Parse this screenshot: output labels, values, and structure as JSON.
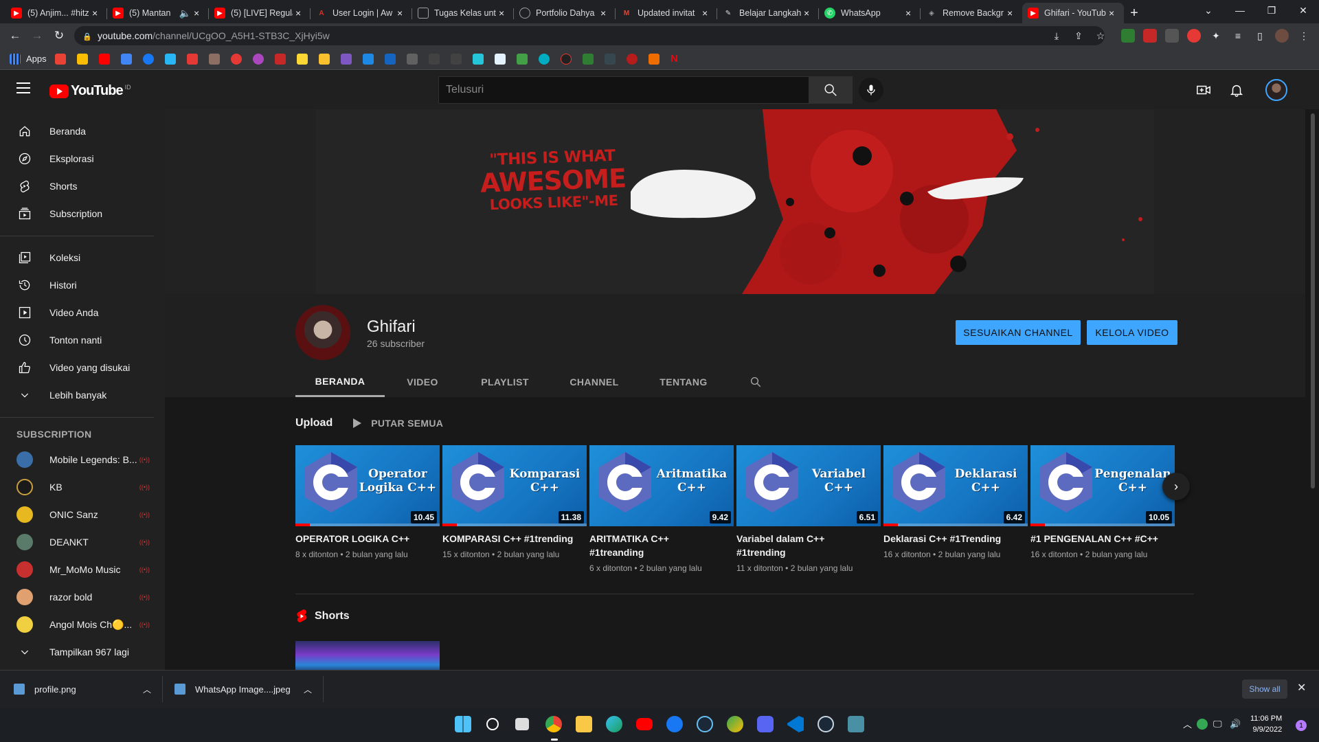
{
  "browser": {
    "tabs": [
      {
        "label": "(5) Anjim... #hitz",
        "favicon_color": "#ff0000"
      },
      {
        "label": "(5) Mantan",
        "favicon_color": "#ff0000"
      },
      {
        "label": "(5) [LIVE] Regula",
        "favicon_color": "#ff0000"
      },
      {
        "label": "User Login | Aw",
        "favicon_color": "#d93025"
      },
      {
        "label": "Tugas Kelas unt",
        "favicon_color": "#9aa0a6"
      },
      {
        "label": "Portfolio Dahya",
        "favicon_color": "#9aa0a6"
      },
      {
        "label": "Updated invitat",
        "favicon_color": "#ea4335"
      },
      {
        "label": "Belajar Langkah",
        "favicon_color": "#9aa0a6"
      },
      {
        "label": "WhatsApp",
        "favicon_color": "#25d366"
      },
      {
        "label": "Remove Backgr",
        "favicon_color": "#9aa0a6"
      },
      {
        "label": "Ghifari - YouTub",
        "favicon_color": "#ff0000"
      }
    ],
    "url_host": "youtube.com",
    "url_path": "/channel/UCgOO_A5H1-STB3C_XjHyi5w",
    "bookmarks_apps_label": "Apps"
  },
  "masthead": {
    "logo_text": "YouTube",
    "country_code": "ID",
    "search_placeholder": "Telusuri"
  },
  "sidebar": {
    "main_items": [
      {
        "label": "Beranda",
        "icon": "home-icon"
      },
      {
        "label": "Eksplorasi",
        "icon": "explore-icon"
      },
      {
        "label": "Shorts",
        "icon": "shorts-icon"
      },
      {
        "label": "Subscription",
        "icon": "subscriptions-icon"
      }
    ],
    "library_items": [
      {
        "label": "Koleksi",
        "icon": "library-icon"
      },
      {
        "label": "Histori",
        "icon": "history-icon"
      },
      {
        "label": "Video Anda",
        "icon": "your-videos-icon"
      },
      {
        "label": "Tonton nanti",
        "icon": "watch-later-icon"
      },
      {
        "label": "Video yang disukai",
        "icon": "liked-icon"
      },
      {
        "label": "Lebih banyak",
        "icon": "chevron-down-icon"
      }
    ],
    "subscription_heading": "SUBSCRIPTION",
    "subscriptions": [
      {
        "label": "Mobile Legends: B...",
        "color": "#3a6ea8",
        "live": true
      },
      {
        "label": "KB",
        "color": "#1a1a1a",
        "live": true
      },
      {
        "label": "ONIC Sanz",
        "color": "#e8b820",
        "live": true
      },
      {
        "label": "DEANKT",
        "color": "#5a7a6a",
        "live": true
      },
      {
        "label": "Mr_MoMo Music",
        "color": "#c83030",
        "live": true
      },
      {
        "label": "razor bold",
        "color": "#e0a070",
        "live": true
      },
      {
        "label": "Angol Mois Ch🟡...",
        "color": "#f0d040",
        "live": true
      }
    ],
    "show_more": "Tampilkan 967 lagi"
  },
  "channel": {
    "name": "Ghifari",
    "subscribers": "26 subscriber",
    "customize_label": "SESUAIKAN CHANNEL",
    "manage_label": "KELOLA VIDEO",
    "banner_quote_line1": "\"THIS IS WHAT",
    "banner_quote_line2": "AWESOME",
    "banner_quote_line3": "LOOKS LIKE\"-ME",
    "tabs": [
      "BERANDA",
      "VIDEO",
      "PLAYLIST",
      "CHANNEL",
      "TENTANG"
    ]
  },
  "uploads": {
    "title": "Upload",
    "play_all": "PUTAR SEMUA",
    "videos": [
      {
        "thumb_text": "Operator Logika C++",
        "duration": "10.45",
        "title": "OPERATOR LOGIKA C++",
        "title2": "",
        "meta": "8 x ditonton • 2 bulan yang lalu",
        "progress": 0.1
      },
      {
        "thumb_text": "Komparasi C++",
        "duration": "11.38",
        "title": "KOMPARASI C++ #1trending",
        "title2": "",
        "meta": "15 x ditonton • 2 bulan yang lalu",
        "progress": 0.1
      },
      {
        "thumb_text": "Aritmatika C++",
        "duration": "9.42",
        "title": "ARITMATIKA C++",
        "title2": "#1treanding",
        "meta": "6 x ditonton • 2 bulan yang lalu",
        "progress": 0.0
      },
      {
        "thumb_text": "Variabel C++",
        "duration": "6.51",
        "title": "Variabel dalam C++",
        "title2": "#1trending",
        "meta": "11 x ditonton • 2 bulan yang lalu",
        "progress": 0.0
      },
      {
        "thumb_text": "Deklarasi C++",
        "duration": "6.42",
        "title": "Deklarasi C++ #1Trending",
        "title2": "",
        "meta": "16 x ditonton • 2 bulan yang lalu",
        "progress": 0.1
      },
      {
        "thumb_text": "Pengenalan C++",
        "duration": "10.05",
        "title": "#1 PENGENALAN C++ #C++",
        "title2": "",
        "meta": "16 x ditonton • 2 bulan yang lalu",
        "progress": 0.1
      }
    ]
  },
  "shorts": {
    "title": "Shorts"
  },
  "downloads": {
    "items": [
      "profile.png",
      "WhatsApp Image....jpeg"
    ],
    "show_all": "Show all"
  },
  "taskbar": {
    "time": "11:06 PM",
    "date": "9/9/2022",
    "notification_count": "1"
  },
  "colors": {
    "accent_blue": "#3ea6ff",
    "youtube_red": "#ff0000",
    "background": "#181818"
  }
}
